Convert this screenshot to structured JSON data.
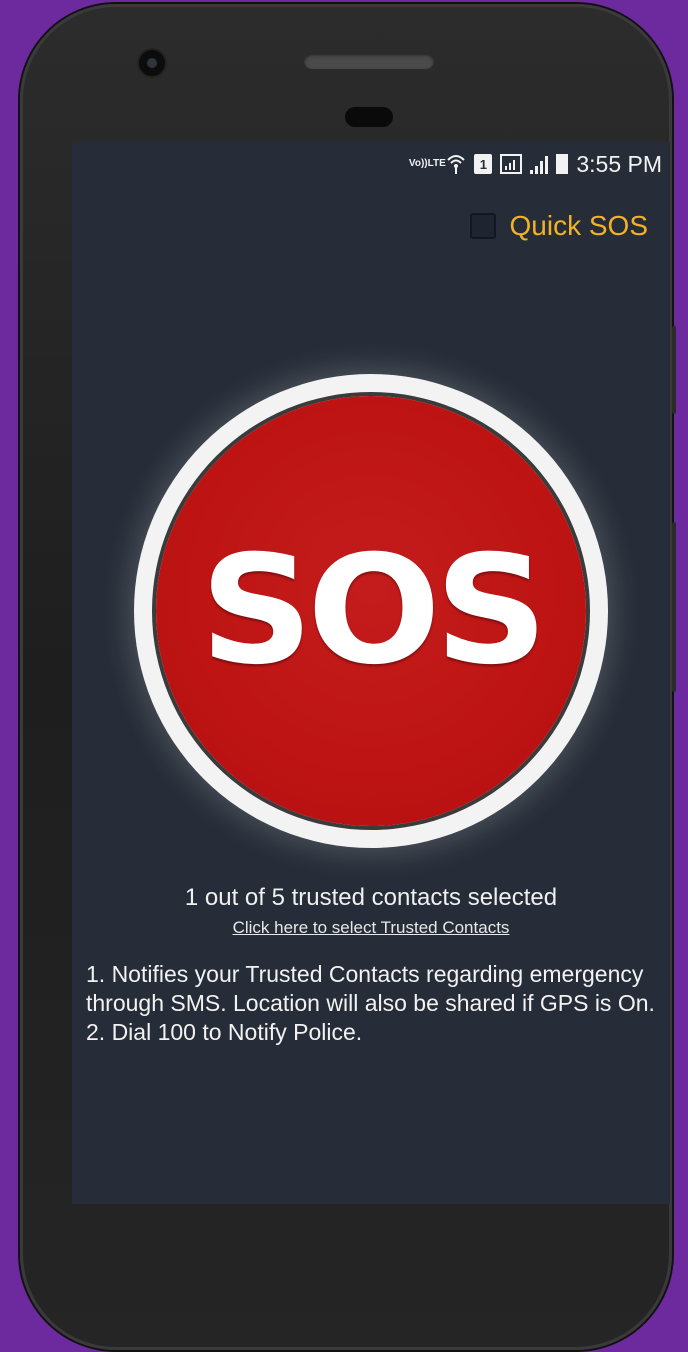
{
  "status_bar": {
    "volte_top": "Vo))",
    "volte_bottom": "LTE",
    "sim_label": "1",
    "time": "3:55 PM"
  },
  "quick_sos": {
    "label": "Quick SOS",
    "checked": false,
    "color": "#f1b224"
  },
  "sos_button": {
    "label": "SOS",
    "color": "#bd1313"
  },
  "trusted": {
    "count_text": "1 out of 5 trusted contacts selected",
    "link_text": "Click here to select Trusted Contacts"
  },
  "info": {
    "line1": "1. Notifies your Trusted Contacts regarding emergency through SMS. Location will also be shared if GPS is On.",
    "line2": "2. Dial 100 to Notify Police."
  },
  "colors": {
    "background": "#6c2a9e",
    "screen": "#262d38",
    "text": "#f2f2f2"
  }
}
